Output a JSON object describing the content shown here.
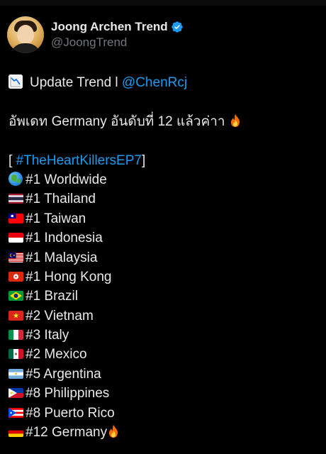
{
  "author": {
    "display_name": "Joong Archen Trend",
    "handle": "@JoongTrend",
    "verified": true,
    "verified_color": "#1d9bf0",
    "avatar_icon": "profile-photo"
  },
  "tweet": {
    "line1_prefix": "Update Trend l ",
    "line1_mention": "@ChenRcj",
    "line2": "อัพเดท Germany อันดับที่ 12 แล้วค่าา ",
    "hashtag_open": "[ ",
    "hashtag": "#TheHeartKillersEP7",
    "hashtag_close": "]",
    "rankings": [
      {
        "icon": "globe-icon",
        "text": "#1 Worldwide"
      },
      {
        "icon": "flag-thailand-icon",
        "text": "#1 Thailand"
      },
      {
        "icon": "flag-taiwan-icon",
        "text": "#1 Taiwan"
      },
      {
        "icon": "flag-indonesia-icon",
        "text": "#1 Indonesia"
      },
      {
        "icon": "flag-malaysia-icon",
        "text": "#1 Malaysia"
      },
      {
        "icon": "flag-hong-kong-icon",
        "text": "#1 Hong Kong"
      },
      {
        "icon": "flag-brazil-icon",
        "text": "#1 Brazil"
      },
      {
        "icon": "flag-vietnam-icon",
        "text": "#2 Vietnam"
      },
      {
        "icon": "flag-italy-icon",
        "text": "#3 Italy"
      },
      {
        "icon": "flag-mexico-icon",
        "text": "#2 Mexico"
      },
      {
        "icon": "flag-argentina-icon",
        "text": "#5 Argentina"
      },
      {
        "icon": "flag-philippines-icon",
        "text": "#8 Philippines"
      },
      {
        "icon": "flag-puerto-rico-icon",
        "text": "#8 Puerto Rico"
      },
      {
        "icon": "flag-germany-icon",
        "text": "#12 Germany"
      }
    ]
  },
  "colors": {
    "background": "#000000",
    "text": "#e7e9ea",
    "secondary_text": "#71767b",
    "link": "#1d9bf0"
  }
}
